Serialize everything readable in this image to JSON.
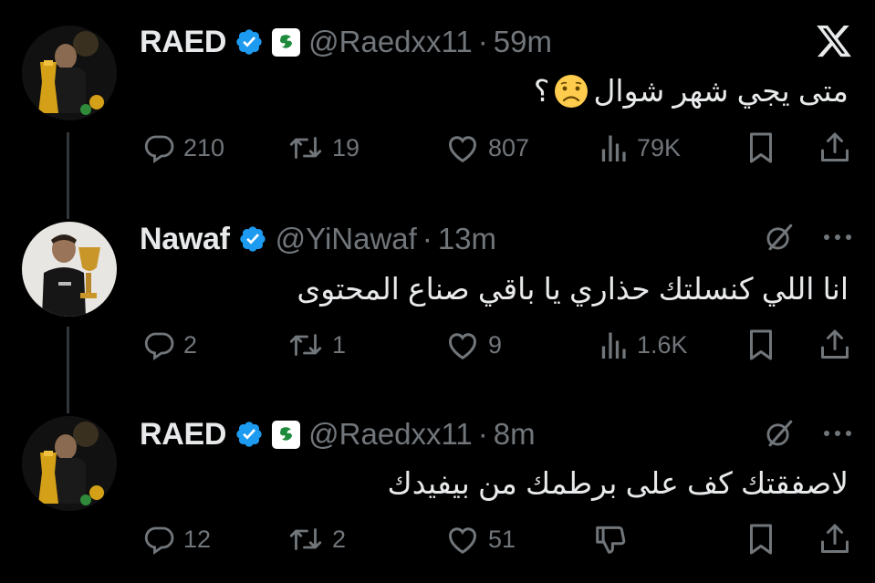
{
  "tweets": [
    {
      "name": "RAED",
      "handle": "@Raedxx11",
      "separator": "·",
      "time": "59m",
      "text": "متى يجي شهر شوال",
      "text_suffix": "؟",
      "emoji": "disappointed-face",
      "replies": "210",
      "reposts": "19",
      "likes": "807",
      "views": "79K",
      "top_icon": "x-logo"
    },
    {
      "name": "Nawaf",
      "handle": "@YiNawaf",
      "separator": "·",
      "time": "13m",
      "text": "انا اللي كنسلتك حذاري يا باقي صناع المحتوى",
      "replies": "2",
      "reposts": "1",
      "likes": "9",
      "views": "1.6K",
      "top_icon": "grok-icon"
    },
    {
      "name": "RAED",
      "handle": "@Raedxx11",
      "separator": "·",
      "time": "8m",
      "text": "لاصفقتك كف على برطمك من بيفيدك",
      "replies": "12",
      "reposts": "2",
      "likes": "51",
      "views": "",
      "top_icon": "grok-icon"
    }
  ],
  "colors": {
    "background": "#000000",
    "text": "#e7e9ea",
    "muted": "#71767b",
    "verified": "#1d9bf0",
    "thread_line": "#333639"
  }
}
